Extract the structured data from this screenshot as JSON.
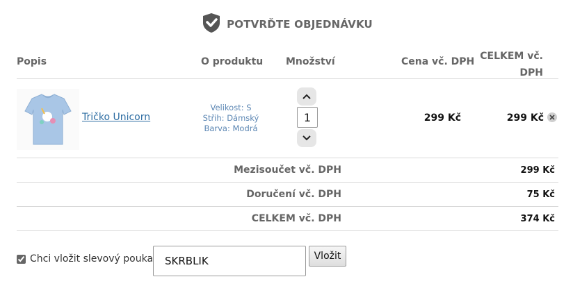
{
  "header": {
    "title": "POTVRĎTE OBJEDNÁVKU",
    "icon": "shield-check-icon"
  },
  "table": {
    "columns": {
      "popis": "Popis",
      "o_produktu": "O produktu",
      "mnozstvi": "Množství",
      "cena": "Cena vč. DPH",
      "celkem_line1": "CELKEM vč.",
      "celkem_line2": "DPH"
    },
    "item": {
      "name": "Tričko Unicorn",
      "attributes": [
        "Velikost: S",
        "Střih: Dámský",
        "Barva: Modrá"
      ],
      "quantity": "1",
      "unit_price": "299 Kč",
      "total": "299 Kč",
      "image_color": "#a9c6e6"
    }
  },
  "summary": {
    "subtotal_label": "Mezisoučet vč. DPH",
    "subtotal_value": "299 Kč",
    "delivery_label": "Doručení vč. DPH",
    "delivery_value": "75 Kč",
    "total_label": "CELKEM vč. DPH",
    "total_value": "374 Kč"
  },
  "coupon": {
    "checkbox_label": "Chci vložit slevový poukaz",
    "checked": true,
    "code": "SKRBLIK",
    "button_label": "Vložit"
  }
}
